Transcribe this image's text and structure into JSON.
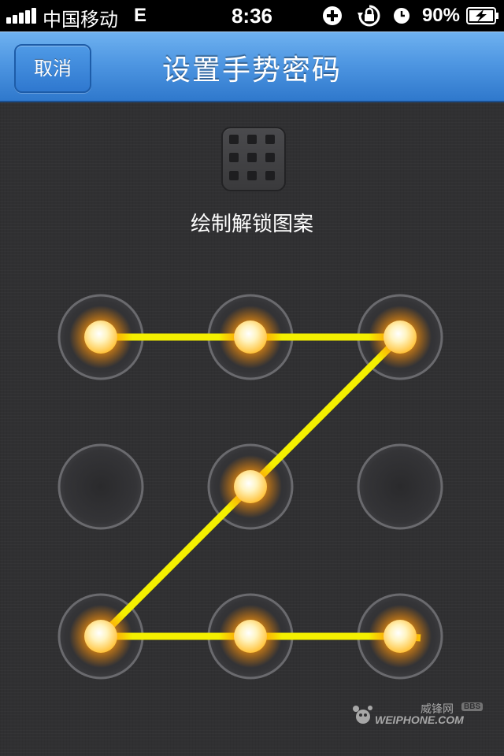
{
  "status_bar": {
    "carrier": "中国移动",
    "network": "E",
    "time": "8:36",
    "battery": "90%"
  },
  "nav": {
    "cancel_label": "取消",
    "title": "设置手势密码"
  },
  "instruction": "绘制解锁图案",
  "pattern": {
    "rows": 3,
    "cols": 3,
    "selected": [
      1,
      1,
      1,
      0,
      1,
      0,
      1,
      1,
      1
    ],
    "path": [
      0,
      1,
      2,
      4,
      6,
      7,
      8
    ],
    "line_color": "#f4f000",
    "glow_color": "#ffb21e"
  },
  "watermark": {
    "cn": "威锋网",
    "bbs": "BBS",
    "en": "WEIPHONE.COM"
  },
  "colors": {
    "nav_blue": "#4f97e2",
    "background": "#303032"
  }
}
